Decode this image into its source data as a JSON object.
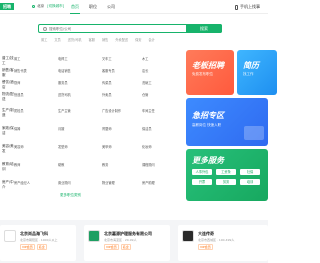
{
  "header": {
    "logo": "招聘",
    "location": "北京",
    "city_switch": "[切换城市]",
    "nav": [
      "首页",
      "职位",
      "公司"
    ],
    "active_nav": "首页",
    "phone_label": "手机上找事"
  },
  "search": {
    "placeholder": "搜索职位/公司",
    "button": "搜索",
    "hot_terms": [
      "普工",
      "文员",
      "送货/司机",
      "客服",
      "销售",
      "外卖配送",
      "保安",
      "会计",
      "服务员"
    ]
  },
  "categories": [
    {
      "name": "普工/技工",
      "items": [
        "普工",
        "电焊工",
        "叉车工",
        "木工",
        "操作工",
        "装卸工",
        "包装工",
        "其他普工"
      ]
    },
    {
      "name": "销售/客服",
      "items": [
        "销售代表",
        "电话销售",
        "客服专员",
        "店长",
        "人事行政助理",
        "市场专员",
        "网络客服",
        "销售经理"
      ]
    },
    {
      "name": "餐饮/酒店",
      "items": [
        "厨师",
        "服务员",
        "传菜员",
        "洗碗工",
        "收银员",
        "面点师",
        "保洁",
        "配菜打荷"
      ]
    },
    {
      "name": "物流/配送",
      "items": [
        "快递员",
        "送货司机",
        "外卖员",
        "仓管",
        "理货员",
        "分拣员",
        "装卸",
        "跟车员"
      ]
    },
    {
      "name": "生产/制造",
      "items": [
        "质检员",
        "生产主管",
        "广告设计制作",
        "车间主任",
        "技术员",
        "装配工",
        "包装",
        "机修工"
      ]
    },
    {
      "name": "家政/保洁",
      "items": [
        "保姆",
        "月嫂",
        "育婴师",
        "保洁员",
        "钟点工",
        "护工",
        "家电维修",
        "搬家"
      ]
    },
    {
      "name": "美容/美发",
      "items": [
        "美容师",
        "发型师",
        "美甲师",
        "化妆师",
        "足疗",
        "按摩",
        "学徒",
        "店长"
      ]
    },
    {
      "name": "教育/培训",
      "items": [
        "教师",
        "助教",
        "教务",
        "课程顾问",
        "幼教",
        "家教",
        "培训师",
        "招生"
      ]
    },
    {
      "name": "房产/中介",
      "items": [
        "房产经纪人",
        "置业顾问",
        "物业管理",
        "房产助理",
        "店长",
        "销售",
        "客服",
        "文员"
      ]
    }
  ],
  "more_link": "更多职位类别",
  "promo": {
    "card1": {
      "title": "老板招聘",
      "sub": "免费发布职位"
    },
    "card2": {
      "title": "简历",
      "sub": "找工作"
    },
    "card3": {
      "title": "急招专区",
      "sub": "高薪岗位 快速入职"
    },
    "card4": {
      "title": "更多服务",
      "buttons": [
        "人事外包",
        "工资条",
        "社保",
        "开票",
        "劳务",
        "培训"
      ]
    }
  },
  "companies": [
    {
      "name": "北京尚品海飞科",
      "meta": "北京市朝阳区 · 1000人以上",
      "badges": [
        "VIP会员",
        "名企"
      ]
    },
    {
      "name": "北京嘉源护理服务有限公司",
      "meta": "北京市海淀区 · 20-99人",
      "badges": [
        "VIP会员",
        "名企"
      ]
    },
    {
      "name": "大连传奇",
      "meta": "北京市西城区 · 100-499人",
      "badges": [
        "VIP会员"
      ]
    }
  ]
}
